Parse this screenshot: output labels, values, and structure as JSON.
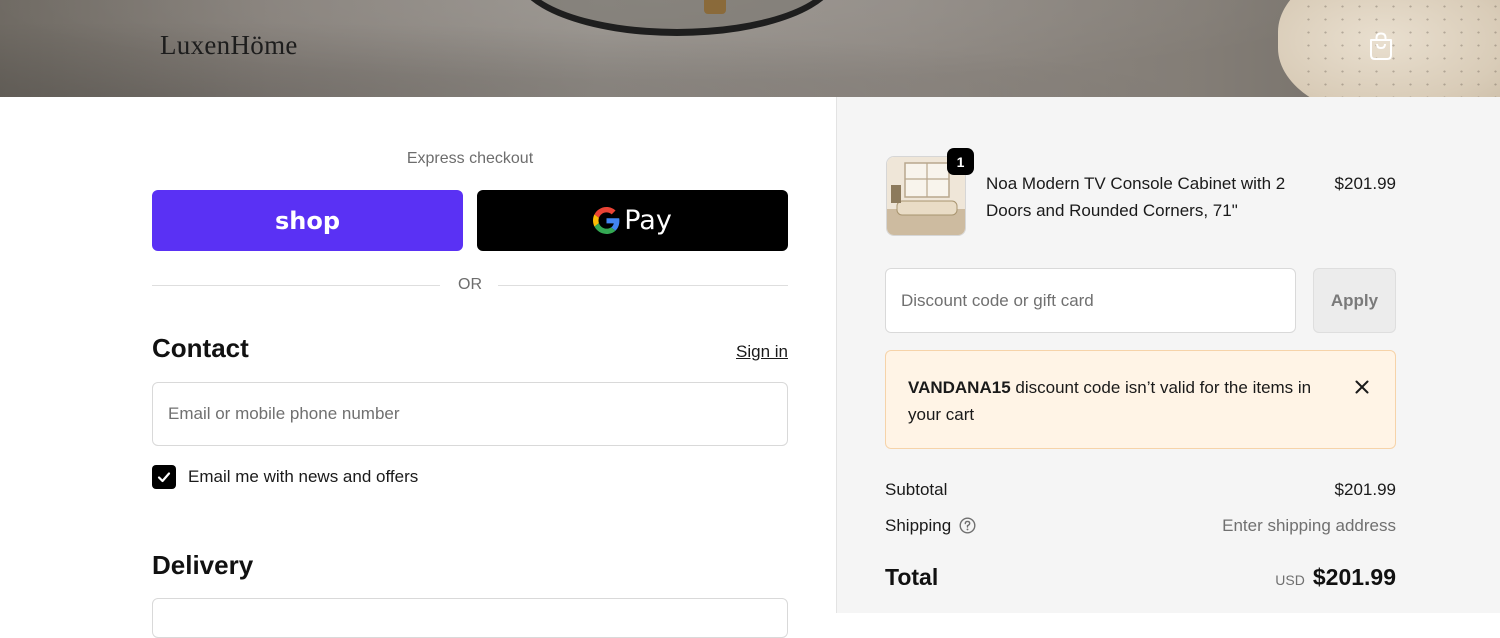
{
  "header": {
    "logo_text": "LuxenHöme"
  },
  "express": {
    "label": "Express checkout",
    "shop_pay_label": "shop",
    "google_pay_label": "Pay",
    "or_text": "OR"
  },
  "contact": {
    "title": "Contact",
    "sign_in": "Sign in",
    "email_placeholder": "Email or mobile phone number",
    "newsletter_label": "Email me with news and offers",
    "newsletter_checked": true
  },
  "delivery": {
    "title": "Delivery"
  },
  "cart": {
    "quantity": "1",
    "product_name": "Noa Modern TV Console Cabinet with 2 Doors and Rounded Corners, 71\"",
    "product_price": "$201.99"
  },
  "discount": {
    "placeholder": "Discount code or gift card",
    "apply_label": "Apply",
    "error_code": "VANDANA15",
    "error_message": " discount code isn’t valid for the items in your cart"
  },
  "totals": {
    "subtotal_label": "Subtotal",
    "subtotal_value": "$201.99",
    "shipping_label": "Shipping",
    "shipping_value": "Enter shipping address",
    "total_label": "Total",
    "currency": "USD",
    "total_value": "$201.99"
  },
  "colors": {
    "shop_pay": "#5a31f4",
    "google_pay": "#000000",
    "alert_bg": "#fff4e6",
    "summary_bg": "#f5f5f5"
  }
}
